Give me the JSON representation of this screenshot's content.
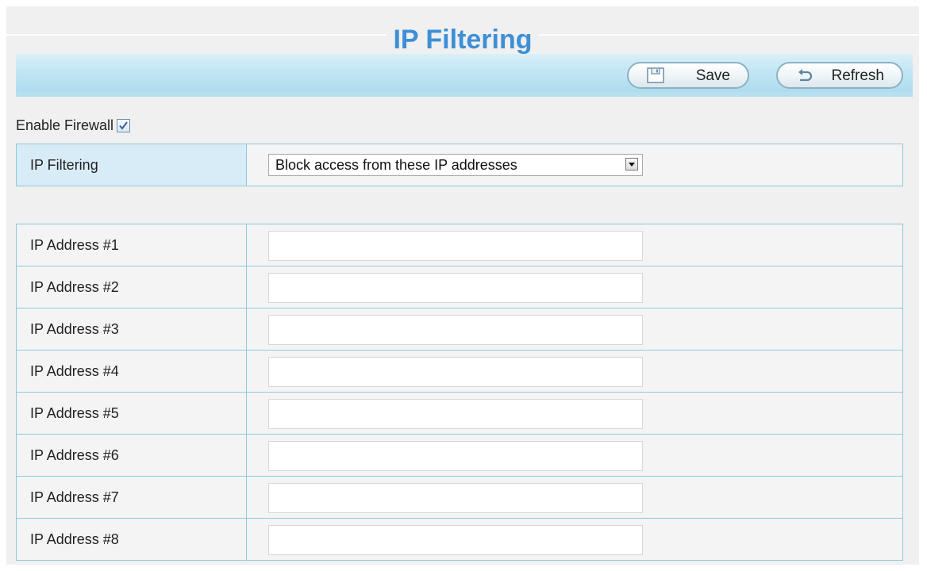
{
  "page": {
    "title": "IP Filtering"
  },
  "toolbar": {
    "save_label": "Save",
    "refresh_label": "Refresh"
  },
  "firewall": {
    "label": "Enable Firewall",
    "checked": true
  },
  "filter": {
    "label": "IP Filtering",
    "selected": "Block access from these IP addresses"
  },
  "ip_addresses": [
    {
      "label": "IP Address #1",
      "value": ""
    },
    {
      "label": "IP Address #2",
      "value": ""
    },
    {
      "label": "IP Address #3",
      "value": ""
    },
    {
      "label": "IP Address #4",
      "value": ""
    },
    {
      "label": "IP Address #5",
      "value": ""
    },
    {
      "label": "IP Address #6",
      "value": ""
    },
    {
      "label": "IP Address #7",
      "value": ""
    },
    {
      "label": "IP Address #8",
      "value": ""
    }
  ],
  "colors": {
    "title": "#3d8fd6",
    "border": "#8fc9dd",
    "toolbar": "#c2e6f3",
    "label_highlight": "#d8ecf7"
  },
  "icons": {
    "save": "save-icon",
    "refresh": "refresh-icon",
    "checkbox": "checkmark-icon",
    "dropdown": "dropdown-arrow-icon"
  }
}
